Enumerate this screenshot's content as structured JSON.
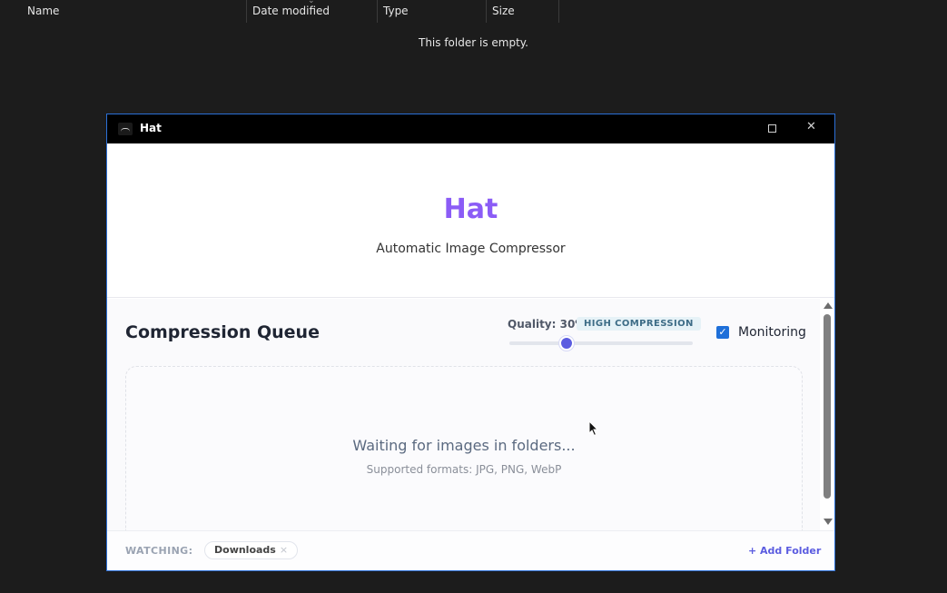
{
  "explorer": {
    "columns": [
      "Name",
      "Date modified",
      "Type",
      "Size"
    ],
    "empty_message": "This folder is empty."
  },
  "window": {
    "title": "Hat",
    "icon": "hat-icon",
    "controls": [
      "maximize-icon",
      "close-icon"
    ]
  },
  "hero": {
    "title": "Hat",
    "subtitle": "Automatic Image Compressor"
  },
  "queue": {
    "title": "Compression Queue",
    "quality_label": "Quality: 30%",
    "quality_value": 0.3,
    "quality_badge": "HIGH COMPRESSION",
    "monitoring_label": "Monitoring",
    "monitoring_checked": true,
    "empty_title": "Waiting for images in folders...",
    "empty_subtitle": "Supported formats: JPG, PNG, WebP"
  },
  "footer": {
    "watching_label": "WATCHING:",
    "folders": [
      "Downloads"
    ],
    "add_folder_label": "+ Add Folder"
  },
  "colors": {
    "accent": "#8b5cf6",
    "slider": "#5b5ce0",
    "checkbox": "#1e6fd9",
    "window_border": "#2b6fd6"
  }
}
